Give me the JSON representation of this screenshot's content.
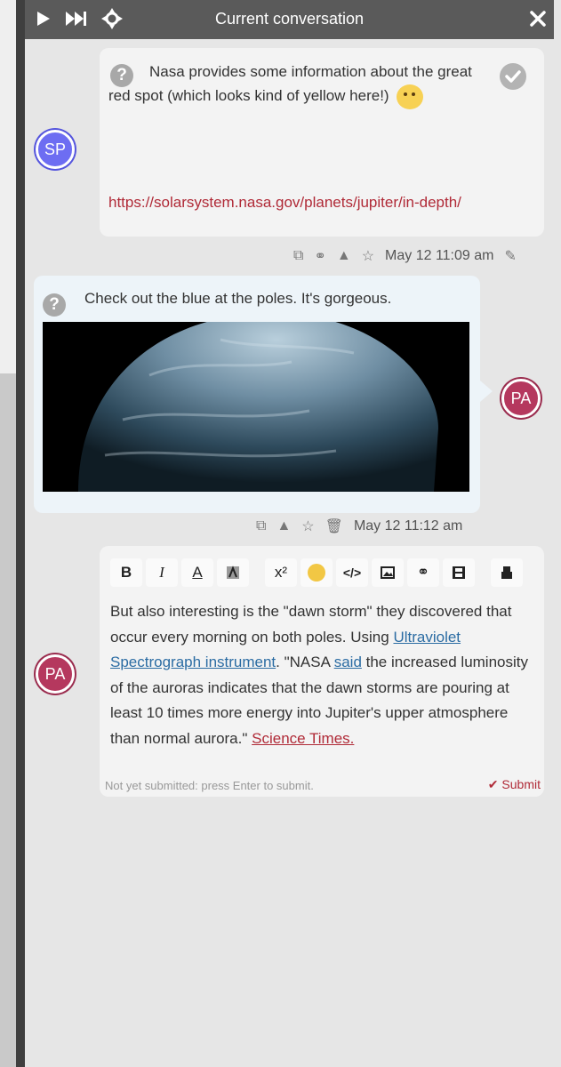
{
  "header": {
    "title": "Current conversation"
  },
  "messages": [
    {
      "author": "SP",
      "text": "Nasa provides some information about the great red spot (which looks kind of yellow here!)",
      "link": "https://solarsystem.nasa.gov/planets/jupiter/in-depth/",
      "timestamp": "May 12 11:09 am"
    },
    {
      "author": "PA",
      "text": "Check out the blue at the poles. It's gorgeous.",
      "timestamp": "May 12 11:12 am"
    }
  ],
  "composer": {
    "author": "PA",
    "text_1": "But also interesting is the \"dawn storm\" they discovered that occur every morning on both poles. Using ",
    "link_1": "Ultraviolet Spectrograph instrument",
    "text_2": ". \"NASA ",
    "link_2": "said",
    "text_3": " the increased luminosity of the auroras indicates that the dawn storms are pouring at least 10 times more energy into Jupiter's upper atmosphere than normal aurora.\" ",
    "link_3": "Science Times.",
    "hint": "Not yet submitted: press Enter to submit.",
    "submit_label": "Submit",
    "toolbar": [
      "B",
      "I",
      "A",
      "x²"
    ]
  },
  "colors": {
    "link_red": "#b02a37",
    "link_blue": "#2b6ca3",
    "header_bg": "#5a5a5a",
    "sp_avatar": "#6d6df2",
    "pa_avatar": "#b5385e"
  },
  "icons": [
    "play-icon",
    "fast-forward-icon",
    "crosshair-icon",
    "close-icon",
    "question-icon",
    "check-icon",
    "copy-icon",
    "link-icon",
    "warning-icon",
    "star-icon",
    "trash-icon",
    "pencil-icon",
    "emoji-icon",
    "code-icon",
    "image-icon",
    "film-icon",
    "bold-icon",
    "italic-icon",
    "font-color-icon",
    "highlight-icon"
  ]
}
